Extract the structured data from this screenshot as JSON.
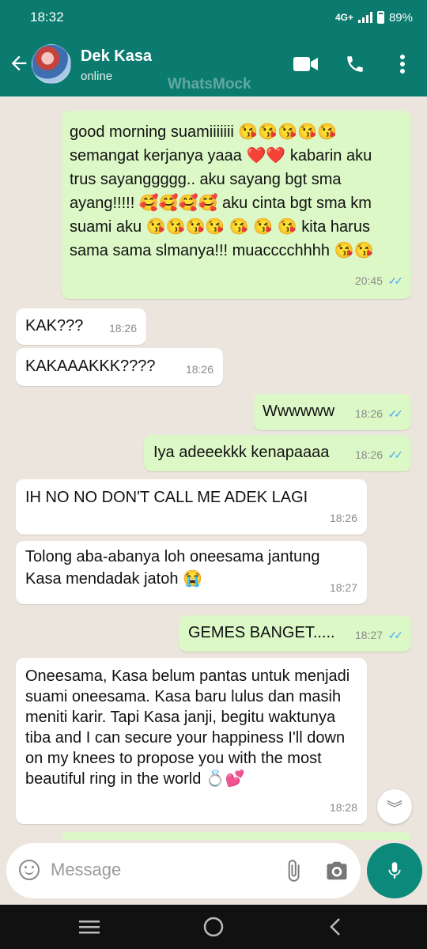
{
  "status_bar": {
    "time": "18:32",
    "network": "4G+",
    "battery": "89%"
  },
  "header": {
    "name": "Dek Kasa",
    "status": "online",
    "watermark": "WhatsMock"
  },
  "messages": [
    {
      "dir": "out",
      "text": "good morning suamiiiiiii 😘😘😘😘😘 semangat kerjanya yaaa ❤️❤️ kabarin aku trus sayanggggg.. aku sayang bgt sma ayang!!!!! 🥰🥰🥰🥰 aku cinta bgt sma km suami aku 😘😘😘😘 😘 😘 😘 kita harus sama sama slmanya!!! muacccchhhh 😘😘",
      "time": "20:45"
    },
    {
      "dir": "in",
      "text": "KAK???",
      "time": "18:26"
    },
    {
      "dir": "in",
      "text": "KAKAAAKKK????",
      "time": "18:26"
    },
    {
      "dir": "out",
      "text": "Wwwwww",
      "time": "18:26"
    },
    {
      "dir": "out",
      "text": "Iya adeeekkk kenapaaaa",
      "time": "18:26"
    },
    {
      "dir": "in",
      "text": "IH NO NO DON'T CALL ME ADEK LAGI",
      "time": "18:26"
    },
    {
      "dir": "in",
      "text": "Tolong aba-abanya loh oneesama jantung Kasa mendadak jatoh 😭",
      "time": "18:27"
    },
    {
      "dir": "out",
      "text": "GEMES BANGET.....",
      "time": "18:27"
    },
    {
      "dir": "in",
      "text": "Oneesama, Kasa belum pantas untuk menjadi suami oneesama. Kasa baru lulus dan masih meniti karir. Tapi Kasa janji, begitu waktunya tiba and I can secure your happiness I'll down on my knees to propose you with the most beautiful ring in the world 💍💕",
      "time": "18:28"
    }
  ],
  "composer": {
    "placeholder": "Message"
  },
  "colors": {
    "header": "#0b7a6f",
    "outgoing": "#dcf8c6",
    "incoming": "#ffffff",
    "ticks": "#4fa9e8",
    "mic": "#0b8a7b"
  }
}
